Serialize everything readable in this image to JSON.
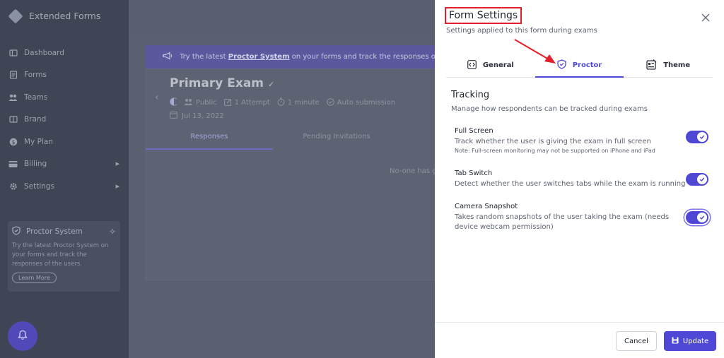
{
  "app": {
    "name": "Extended Forms"
  },
  "sidebar": {
    "items": [
      {
        "label": "Dashboard"
      },
      {
        "label": "Forms"
      },
      {
        "label": "Teams"
      },
      {
        "label": "Brand"
      },
      {
        "label": "My Plan"
      },
      {
        "label": "Billing"
      },
      {
        "label": "Settings"
      }
    ],
    "promo": {
      "title": "Proctor System",
      "text": "Try the latest Proctor System on your forms and track the responses of the users.",
      "button": "Learn More"
    }
  },
  "background": {
    "banner": {
      "prefix": "Try the latest",
      "link": "Proctor System",
      "suffix": "on your forms and track the responses of the"
    },
    "exam": {
      "title": "Primary Exam",
      "visibility": "Public",
      "attempts": "1 Attempt",
      "duration": "1 minute",
      "submission": "Auto submission",
      "date": "Jul 13, 2022"
    },
    "tabs": [
      "Responses",
      "Pending Invitations"
    ],
    "empty": "No-one has g"
  },
  "modal": {
    "title": "Form Settings",
    "subtitle": "Settings applied to this form during exams",
    "tabs": [
      {
        "label": "General"
      },
      {
        "label": "Proctor"
      },
      {
        "label": "Theme"
      }
    ],
    "section": {
      "title": "Tracking",
      "subtitle": "Manage how respondents can be tracked during exams"
    },
    "settings": [
      {
        "title": "Full Screen",
        "desc": "Track whether the user is giving the exam in full screen",
        "note": "Note: Full-screen monitoring may not be supported on iPhone and iPad"
      },
      {
        "title": "Tab Switch",
        "desc": "Detect whether the user switches tabs while the exam is running"
      },
      {
        "title": "Camera Snapshot",
        "desc": "Takes random snapshots of the user taking the exam (needs device webcam permission)"
      }
    ],
    "footer": {
      "cancel": "Cancel",
      "update": "Update"
    }
  },
  "colors": {
    "accent": "#4f48d6",
    "highlight_box": "#e3202a",
    "overlay": "#5b6071"
  }
}
